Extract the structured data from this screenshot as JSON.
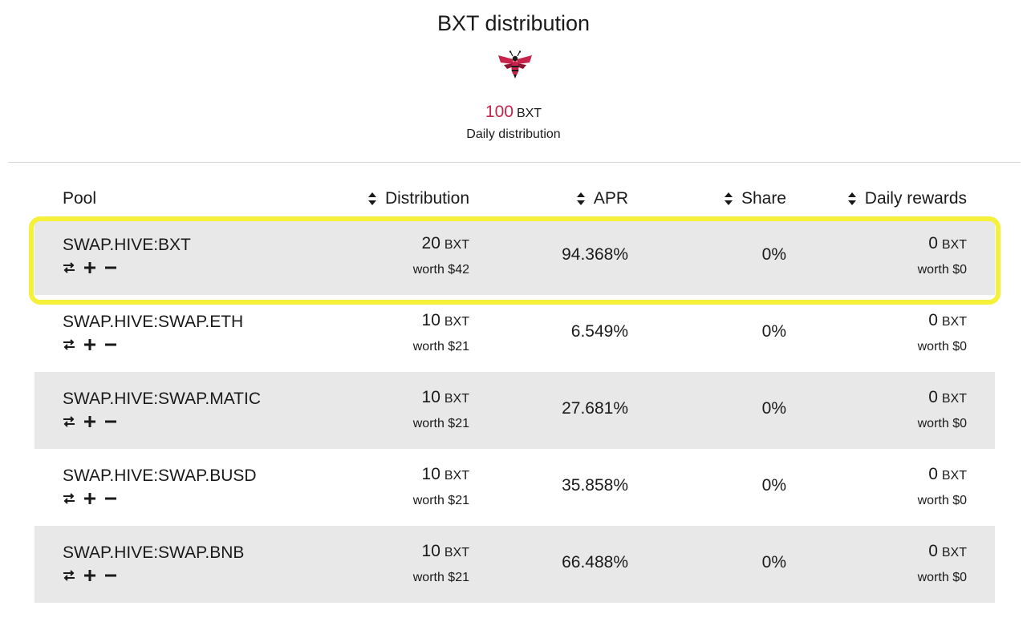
{
  "header": {
    "title": "BXT distribution",
    "amount": "100",
    "amount_unit": "BXT",
    "daily_label": "Daily distribution",
    "logo_icon": "bee-icon",
    "accent_color": "#c8234a"
  },
  "table": {
    "columns": {
      "pool": "Pool",
      "distribution": "Distribution",
      "apr": "APR",
      "share": "Share",
      "daily_rewards": "Daily rewards"
    },
    "rows": [
      {
        "pool": "SWAP.HIVE:BXT",
        "dist_amount": "20",
        "dist_unit": "BXT",
        "dist_worth": "worth $42",
        "apr": "94.368%",
        "share": "0%",
        "reward_amount": "0",
        "reward_unit": "BXT",
        "reward_worth": "worth $0"
      },
      {
        "pool": "SWAP.HIVE:SWAP.ETH",
        "dist_amount": "10",
        "dist_unit": "BXT",
        "dist_worth": "worth $21",
        "apr": "6.549%",
        "share": "0%",
        "reward_amount": "0",
        "reward_unit": "BXT",
        "reward_worth": "worth $0"
      },
      {
        "pool": "SWAP.HIVE:SWAP.MATIC",
        "dist_amount": "10",
        "dist_unit": "BXT",
        "dist_worth": "worth $21",
        "apr": "27.681%",
        "share": "0%",
        "reward_amount": "0",
        "reward_unit": "BXT",
        "reward_worth": "worth $0"
      },
      {
        "pool": "SWAP.HIVE:SWAP.BUSD",
        "dist_amount": "10",
        "dist_unit": "BXT",
        "dist_worth": "worth $21",
        "apr": "35.858%",
        "share": "0%",
        "reward_amount": "0",
        "reward_unit": "BXT",
        "reward_worth": "worth $0"
      },
      {
        "pool": "SWAP.HIVE:SWAP.BNB",
        "dist_amount": "10",
        "dist_unit": "BXT",
        "dist_worth": "worth $21",
        "apr": "66.488%",
        "share": "0%",
        "reward_amount": "0",
        "reward_unit": "BXT",
        "reward_worth": "worth $0"
      }
    ],
    "row_actions": [
      "swap-icon",
      "add-liquidity-icon",
      "remove-liquidity-icon"
    ],
    "highlight_color": "#f5f03a"
  }
}
